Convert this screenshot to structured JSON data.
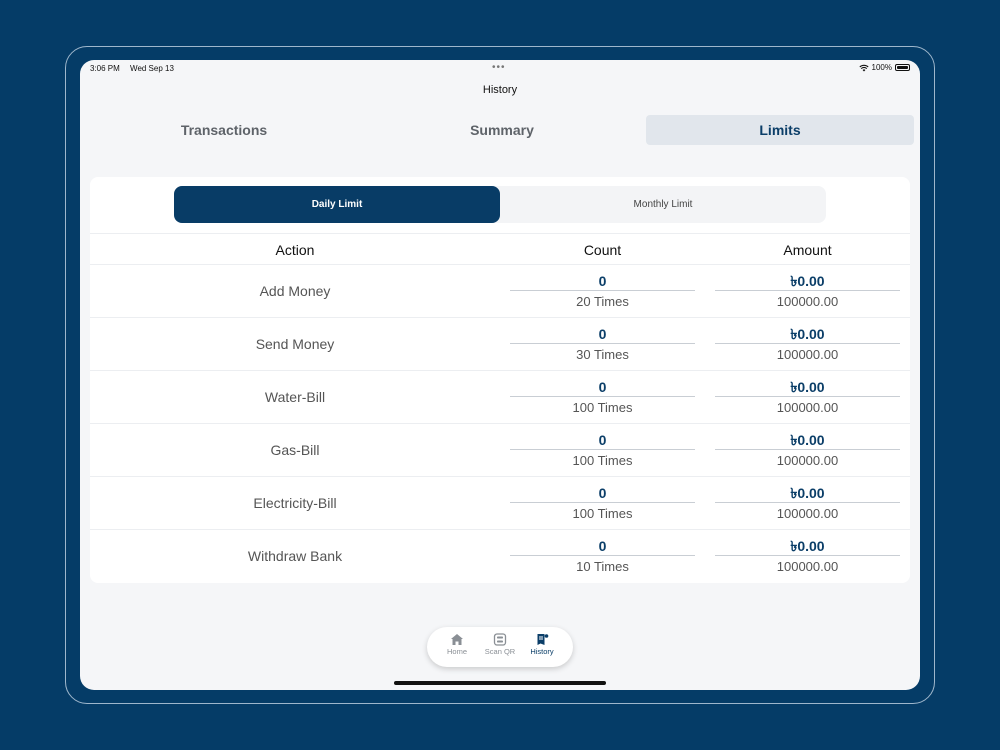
{
  "status_bar": {
    "time": "3:06 PM",
    "date": "Wed Sep 13",
    "battery": "100%"
  },
  "nav": {
    "title": "History"
  },
  "top_tabs": [
    {
      "label": "Transactions"
    },
    {
      "label": "Summary"
    },
    {
      "label": "Limits"
    }
  ],
  "segments": [
    {
      "label": "Daily Limit"
    },
    {
      "label": "Monthly Limit"
    }
  ],
  "table": {
    "headers": {
      "action": "Action",
      "count": "Count",
      "amount": "Amount"
    },
    "rows": [
      {
        "action": "Add Money",
        "count": "0",
        "count_limit": "20 Times",
        "amount": "৳0.00",
        "amount_limit": "100000.00"
      },
      {
        "action": "Send Money",
        "count": "0",
        "count_limit": "30 Times",
        "amount": "৳0.00",
        "amount_limit": "100000.00"
      },
      {
        "action": "Water-Bill",
        "count": "0",
        "count_limit": "100 Times",
        "amount": "৳0.00",
        "amount_limit": "100000.00"
      },
      {
        "action": "Gas-Bill",
        "count": "0",
        "count_limit": "100 Times",
        "amount": "৳0.00",
        "amount_limit": "100000.00"
      },
      {
        "action": "Electricity-Bill",
        "count": "0",
        "count_limit": "100 Times",
        "amount": "৳0.00",
        "amount_limit": "100000.00"
      },
      {
        "action": "Withdraw Bank",
        "count": "0",
        "count_limit": "10 Times",
        "amount": "৳0.00",
        "amount_limit": "100000.00"
      }
    ]
  },
  "bottom_nav": [
    {
      "label": "Home",
      "icon": "home-icon"
    },
    {
      "label": "Scan QR",
      "icon": "scan-qr-icon"
    },
    {
      "label": "History",
      "icon": "history-icon"
    }
  ],
  "colors": {
    "brand": "#083c66",
    "background": "#053c67",
    "active_tab_bg": "#e1e6ec"
  }
}
